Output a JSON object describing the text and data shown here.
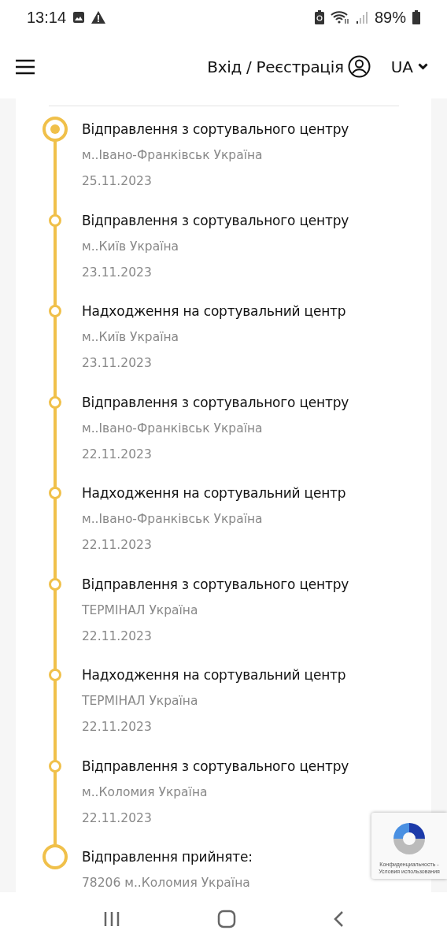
{
  "status_bar": {
    "time": "13:14",
    "battery": "89%"
  },
  "header": {
    "login": "Вхід / Реєстрація",
    "language": "UA"
  },
  "tracking": [
    {
      "kind": "current",
      "title": "Відправлення з сортувального центру",
      "place": "м..Івано-Франківськ Україна",
      "date": "25.11.2023"
    },
    {
      "kind": "step",
      "title": "Відправлення з сортувального центру",
      "place": "м..Київ Україна",
      "date": "23.11.2023"
    },
    {
      "kind": "step",
      "title": "Надходження на сортувальний центр",
      "place": "м..Київ Україна",
      "date": "23.11.2023"
    },
    {
      "kind": "step",
      "title": "Відправлення з сортувального центру",
      "place": "м..Івано-Франківськ Україна",
      "date": "22.11.2023"
    },
    {
      "kind": "step",
      "title": "Надходження на сортувальний центр",
      "place": "м..Івано-Франківськ Україна",
      "date": "22.11.2023"
    },
    {
      "kind": "step",
      "title": "Відправлення з сортувального центру",
      "place": "ТЕРМІНАЛ Україна",
      "date": "22.11.2023"
    },
    {
      "kind": "step",
      "title": "Надходження на сортувальний центр",
      "place": "ТЕРМІНАЛ Україна",
      "date": "22.11.2023"
    },
    {
      "kind": "step",
      "title": "Відправлення з сортувального центру",
      "place": "м..Коломия Україна",
      "date": "22.11.2023"
    },
    {
      "kind": "origin",
      "title": "Відправлення прийняте:",
      "place": "78206 м..Коломия Україна"
    }
  ],
  "recaptcha": {
    "links": "Конфиденциальность - Условия использования"
  }
}
